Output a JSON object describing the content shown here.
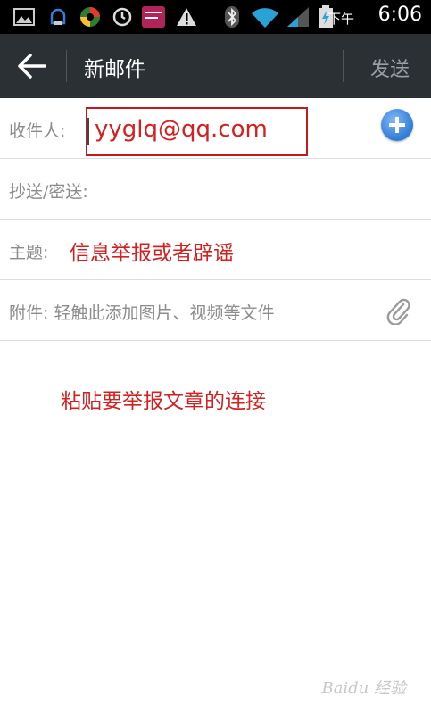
{
  "status_bar": {
    "time": "6:06",
    "ampm": "下午",
    "icons": [
      "image-icon",
      "alarm-icon",
      "camera-app-icon",
      "sync-icon",
      "app-badge-icon",
      "warning-icon",
      "bluetooth-icon",
      "wifi-icon",
      "signal-icon",
      "battery-charging-icon"
    ]
  },
  "app_bar": {
    "title": "新邮件",
    "send_label": "发送"
  },
  "compose": {
    "to_label": "收件人:",
    "to_value": "yyglq@qq.com",
    "cc_label": "抄送/密送:",
    "subject_label": "主题:",
    "subject_value": "信息举报或者辟谣",
    "attachment_hint": "附件: 轻触此添加图片、视频等文件",
    "body": "粘贴要举报文章的连接"
  },
  "colors": {
    "app_bar": "#2b3035",
    "annotation_red": "#d32020",
    "add_button_blue": "#2f7bd6"
  }
}
